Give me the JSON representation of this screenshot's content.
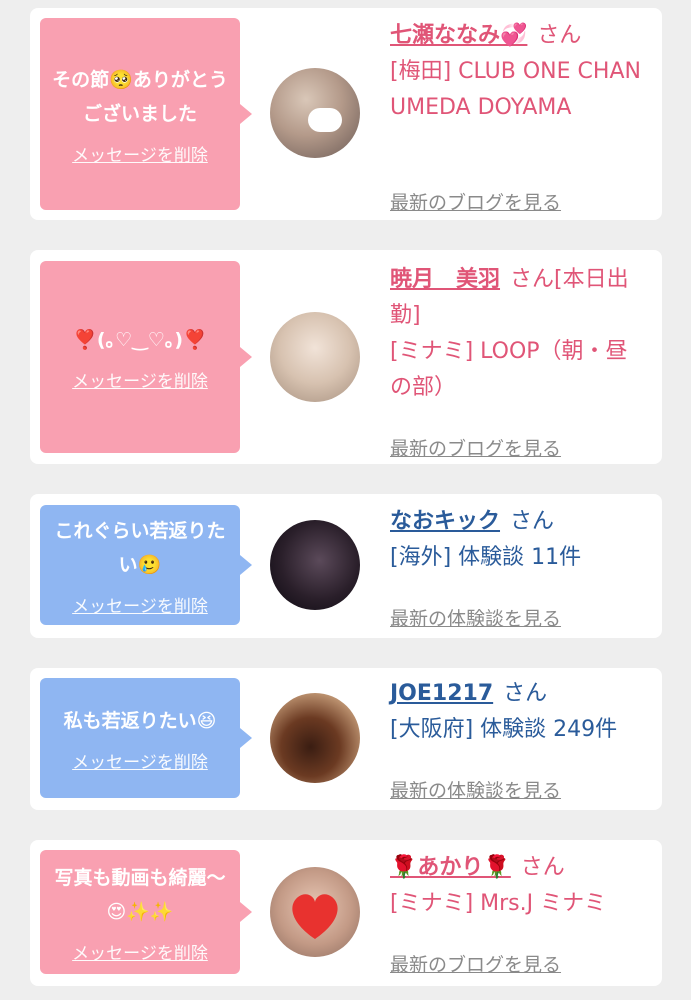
{
  "delete_label": "メッセージを削除",
  "san": "さん",
  "items": [
    {
      "message": "その節🥺ありがとうございました",
      "name": "七瀬ななみ💞",
      "san_suffix": "",
      "info": "[梅田] CLUB ONE CHAN UMEDA DOYAMA",
      "more": "最新のブログを見る",
      "color": "#f9a0b1"
    },
    {
      "message": "❣️(｡♡‿♡｡)❣️",
      "name": "暁月　美羽",
      "san_suffix": "[本日出勤]",
      "info": "[ミナミ] LOOP（朝・昼の部）",
      "more": "最新のブログを見る",
      "color": "#f9a0b1"
    },
    {
      "message": "これぐらい若返りたい🥲",
      "name": "なおキック",
      "san_suffix": "",
      "info": "[海外] 体験談 11件",
      "more": "最新の体験談を見る",
      "color": "#8fb6f2"
    },
    {
      "message": "私も若返りたい😆",
      "name": "JOE1217",
      "san_suffix": "",
      "info": "[大阪府] 体験談 249件",
      "more": "最新の体験談を見る",
      "color": "#8fb6f2"
    },
    {
      "message": "写真も動画も綺麗〜😍✨✨",
      "name": "🌹あかり🌹",
      "san_suffix": "",
      "info": "[ミナミ] Mrs.J ミナミ",
      "more": "最新のブログを見る",
      "color": "#f9a0b1"
    }
  ]
}
